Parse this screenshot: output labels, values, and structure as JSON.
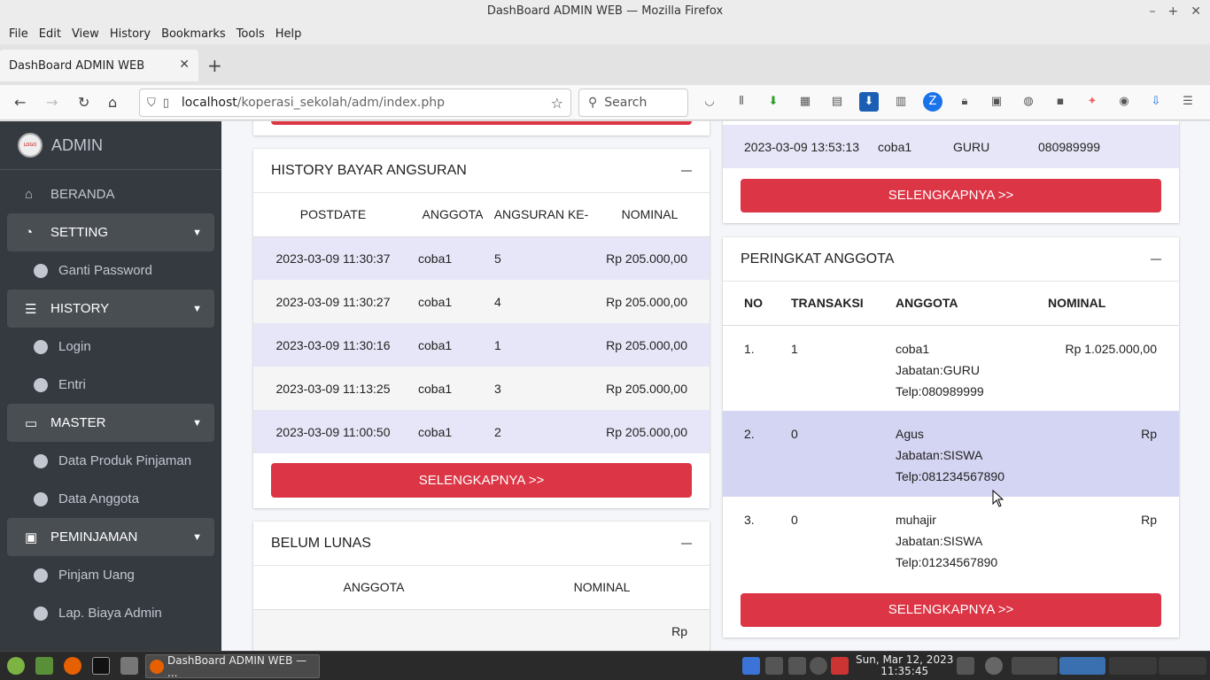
{
  "window": {
    "title": "DashBoard ADMIN WEB — Mozilla Firefox"
  },
  "menu": [
    "File",
    "Edit",
    "View",
    "History",
    "Bookmarks",
    "Tools",
    "Help"
  ],
  "tab": {
    "title": "DashBoard ADMIN WEB"
  },
  "address": {
    "host": "localhost",
    "path": "/koperasi_sekolah/adm/index.php",
    "search_placeholder": "Search"
  },
  "sidebar": {
    "brand": "ADMIN",
    "logo_text": "LOGO",
    "items": [
      {
        "label": "BERANDA",
        "icon": "home-icon",
        "type": "top"
      },
      {
        "label": "SETTING",
        "icon": "gauge-icon",
        "type": "head"
      },
      {
        "label": "Ganti Password",
        "icon": "circle-arrow-icon",
        "type": "sub"
      },
      {
        "label": "HISTORY",
        "icon": "list-icon",
        "type": "head"
      },
      {
        "label": "Login",
        "icon": "circle-arrow-icon",
        "type": "sub"
      },
      {
        "label": "Entri",
        "icon": "circle-arrow-icon",
        "type": "sub"
      },
      {
        "label": "MASTER",
        "icon": "briefcase-icon",
        "type": "head"
      },
      {
        "label": "Data Produk Pinjaman",
        "icon": "circle-arrow-icon",
        "type": "sub"
      },
      {
        "label": "Data Anggota",
        "icon": "circle-arrow-icon",
        "type": "sub"
      },
      {
        "label": "PEMINJAMAN",
        "icon": "money-icon",
        "type": "head"
      },
      {
        "label": "Pinjam Uang",
        "icon": "circle-arrow-icon",
        "type": "sub"
      },
      {
        "label": "Lap. Biaya Admin",
        "icon": "circle-arrow-icon",
        "type": "sub"
      }
    ]
  },
  "top_right_row": {
    "date": "2023-03-09 13:53:13",
    "name": "coba1",
    "jabatan": "GURU",
    "telp": "080989999"
  },
  "more_label": "SELENGKAPNYA >>",
  "history_bayar": {
    "title": "HISTORY BAYAR ANGSURAN",
    "columns": [
      "POSTDATE",
      "ANGGOTA",
      "ANGSURAN KE-",
      "NOMINAL"
    ],
    "rows": [
      [
        "2023-03-09 11:30:37",
        "coba1",
        "5",
        "Rp 205.000,00"
      ],
      [
        "2023-03-09 11:30:27",
        "coba1",
        "4",
        "Rp 205.000,00"
      ],
      [
        "2023-03-09 11:30:16",
        "coba1",
        "1",
        "Rp 205.000,00"
      ],
      [
        "2023-03-09 11:13:25",
        "coba1",
        "3",
        "Rp 205.000,00"
      ],
      [
        "2023-03-09 11:00:50",
        "coba1",
        "2",
        "Rp 205.000,00"
      ]
    ]
  },
  "belum_lunas": {
    "title": "BELUM LUNAS",
    "columns": [
      "ANGGOTA",
      "NOMINAL"
    ],
    "first_value": "Rp"
  },
  "peringkat": {
    "title": "PERINGKAT ANGGOTA",
    "columns": [
      "NO",
      "TRANSAKSI",
      "ANGGOTA",
      "NOMINAL"
    ],
    "rows": [
      {
        "no": "1.",
        "trans": "1",
        "name": "coba1",
        "jabatan": "Jabatan:GURU",
        "telp": "Telp:080989999",
        "nominal": "Rp 1.025.000,00"
      },
      {
        "no": "2.",
        "trans": "0",
        "name": "Agus",
        "jabatan": "Jabatan:SISWA",
        "telp": "Telp:081234567890",
        "nominal": "Rp"
      },
      {
        "no": "3.",
        "trans": "0",
        "name": "muhajir",
        "jabatan": "Jabatan:SISWA",
        "telp": "Telp:01234567890",
        "nominal": "Rp"
      }
    ]
  },
  "taskbar": {
    "task_label": "DashBoard ADMIN WEB — ...",
    "date": "Sun, Mar 12, 2023",
    "time": "11:35:45"
  }
}
